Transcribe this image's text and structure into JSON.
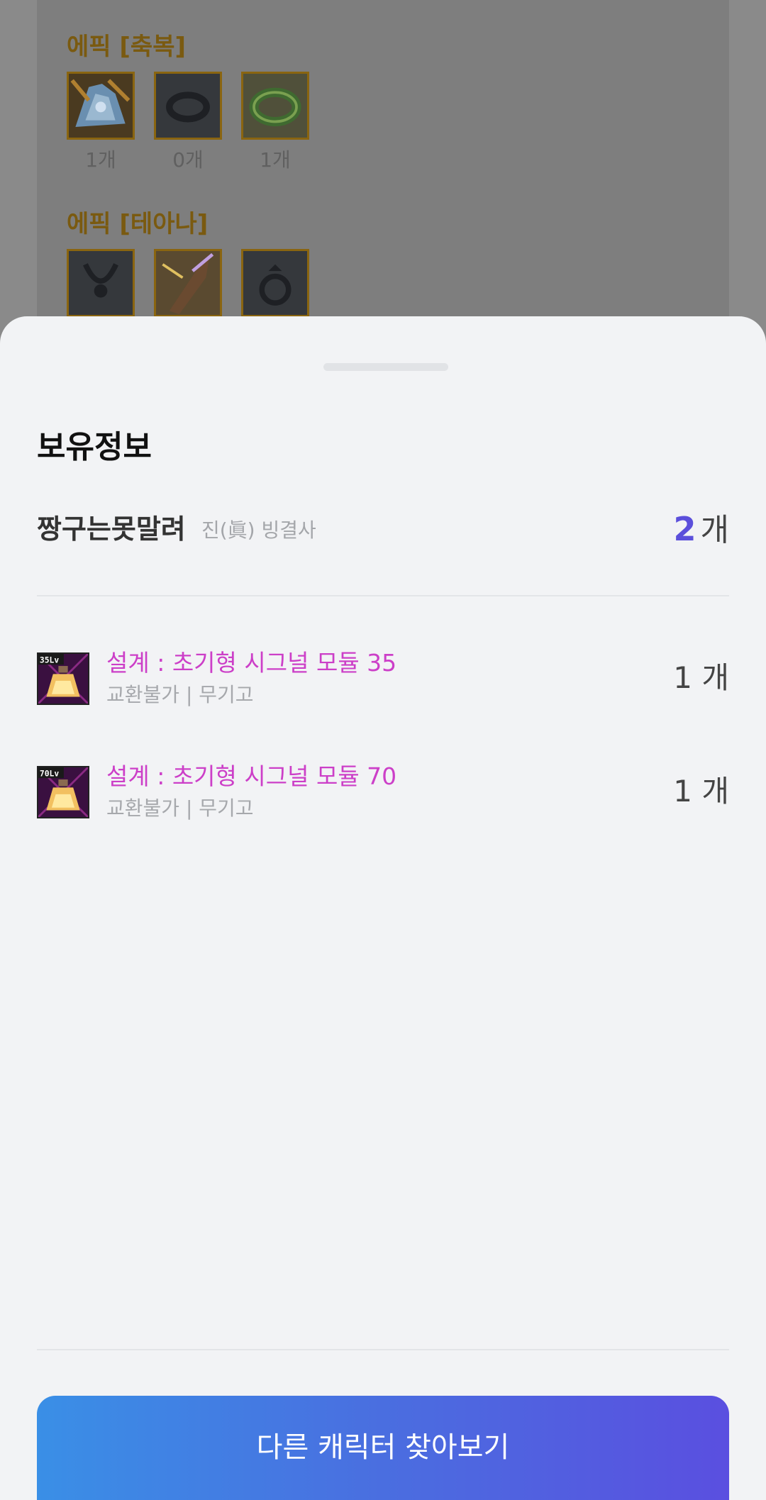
{
  "background": {
    "sections": [
      {
        "title": "에픽 [축복]",
        "items": [
          {
            "icon": "epic-armor-icon",
            "count": "1개"
          },
          {
            "icon": "bracelet-icon",
            "count": "0개"
          },
          {
            "icon": "green-ring-icon",
            "count": "1개"
          }
        ]
      },
      {
        "title": "에픽 [테아나]",
        "items": [
          {
            "icon": "necklace-icon"
          },
          {
            "icon": "epic-weapon-icon"
          },
          {
            "icon": "ring-icon"
          }
        ]
      }
    ]
  },
  "sheet": {
    "title": "보유정보",
    "character": {
      "name": "짱구는못말려",
      "class": "진(眞) 빙결사",
      "total_count": "2",
      "total_unit": "개"
    },
    "items": [
      {
        "name": "설계 : 초기형 시그널 모듈 35",
        "sub": "교환불가 | 무기고",
        "qty": "1 개",
        "icon_label": "35Lv",
        "icon": "blueprint-potion-icon"
      },
      {
        "name": "설계 : 초기형 시그널 모듈 70",
        "sub": "교환불가 | 무기고",
        "qty": "1 개",
        "icon_label": "70Lv",
        "icon": "blueprint-potion-icon"
      }
    ],
    "cta_label": "다른 캐릭터 찾아보기"
  },
  "colors": {
    "accent": "#5b4fdb",
    "item_name": "#cc3fc8",
    "epic_title": "#7a5a10",
    "cta_gradient_start": "#3a8fe6",
    "cta_gradient_end": "#5a4fe0"
  }
}
